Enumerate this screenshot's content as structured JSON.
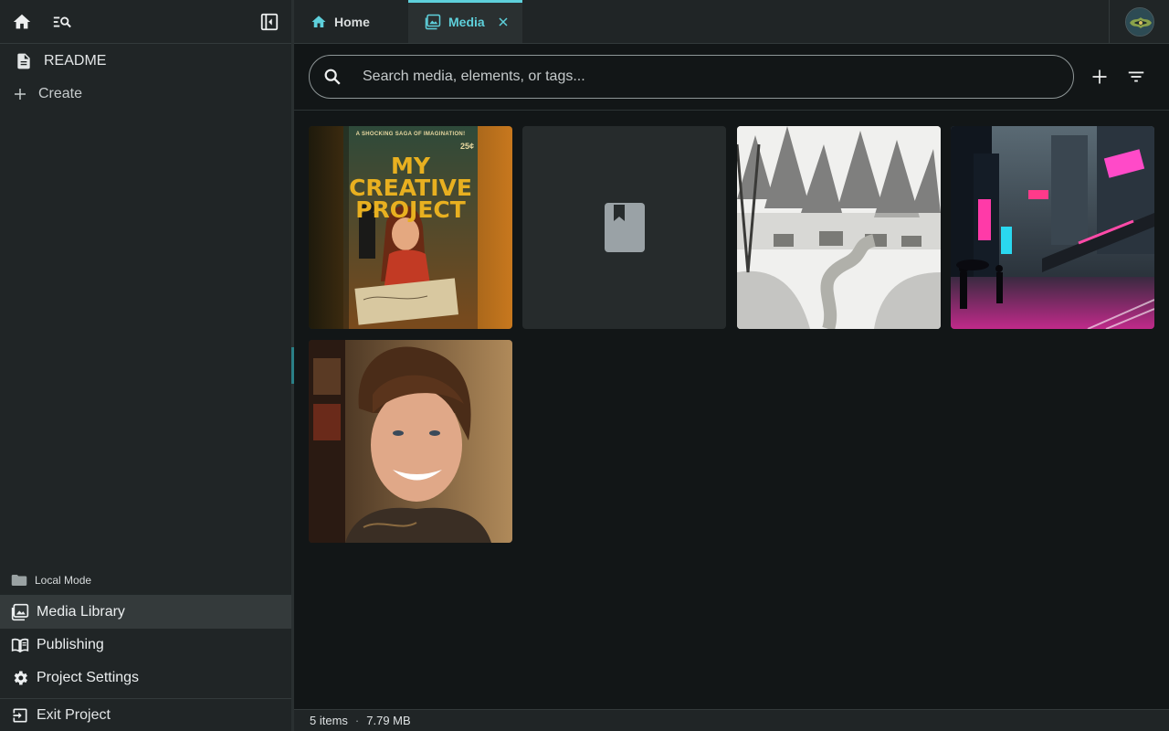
{
  "sidebar": {
    "tree": [
      {
        "label": "README",
        "icon": "document-icon"
      },
      {
        "label": "Create",
        "icon": "plus-icon"
      }
    ],
    "mode_label": "Local Mode",
    "nav": [
      {
        "label": "Media Library",
        "icon": "media-library-icon",
        "active": true
      },
      {
        "label": "Publishing",
        "icon": "publishing-icon"
      },
      {
        "label": "Project Settings",
        "icon": "gear-icon"
      }
    ],
    "exit_label": "Exit Project"
  },
  "tabs": [
    {
      "label": "Home",
      "icon": "home-icon",
      "active": false
    },
    {
      "label": "Media",
      "icon": "media-icon",
      "active": true
    }
  ],
  "search": {
    "placeholder": "Search media, elements, or tags..."
  },
  "cover": {
    "tagline": "A SHOCKING SAGA OF IMAGINATION!",
    "line1": "MY",
    "line2": "CREATIVE",
    "line3": "PROJECT",
    "price": "25¢"
  },
  "media_items": [
    {
      "name": "pulp-cover-image",
      "kind": "image"
    },
    {
      "name": "placeholder-book",
      "kind": "placeholder"
    },
    {
      "name": "forest-village-sketch",
      "kind": "image"
    },
    {
      "name": "cyberpunk-city-night",
      "kind": "image"
    },
    {
      "name": "smiling-man-portrait",
      "kind": "image"
    }
  ],
  "status": {
    "items": "5 items",
    "separator": "·",
    "size": "7.79 MB"
  },
  "colors": {
    "accent": "#5ed0db",
    "sidebar_bg": "#202526",
    "main_bg": "#121617"
  }
}
